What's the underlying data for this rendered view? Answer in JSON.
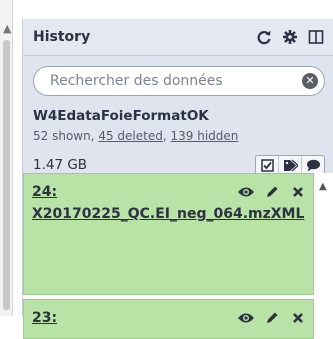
{
  "panel": {
    "title": "History",
    "icons": [
      "refresh-icon",
      "gear-icon",
      "columns-icon"
    ]
  },
  "search": {
    "placeholder": "Rechercher des données"
  },
  "history": {
    "name": "W4EdataFoieFormatOK",
    "shown_label": "52 shown, ",
    "deleted_label": "45 deleted",
    "sep": ", ",
    "hidden_label": "139 hidden",
    "size": "1.47 GB",
    "actions": [
      "checkbox-icon",
      "tags-icon",
      "comment-icon"
    ]
  },
  "datasets": [
    {
      "hid": "24:",
      "name": "X20170225_QC.EI_neg_064.mzXML",
      "state_color": "#b8e2a6",
      "actions": [
        "eye-icon",
        "pencil-icon",
        "delete-icon"
      ]
    },
    {
      "hid": "23:",
      "name": "",
      "state_color": "#b8e2a6",
      "actions": [
        "eye-icon",
        "pencil-icon",
        "delete-icon"
      ]
    }
  ]
}
